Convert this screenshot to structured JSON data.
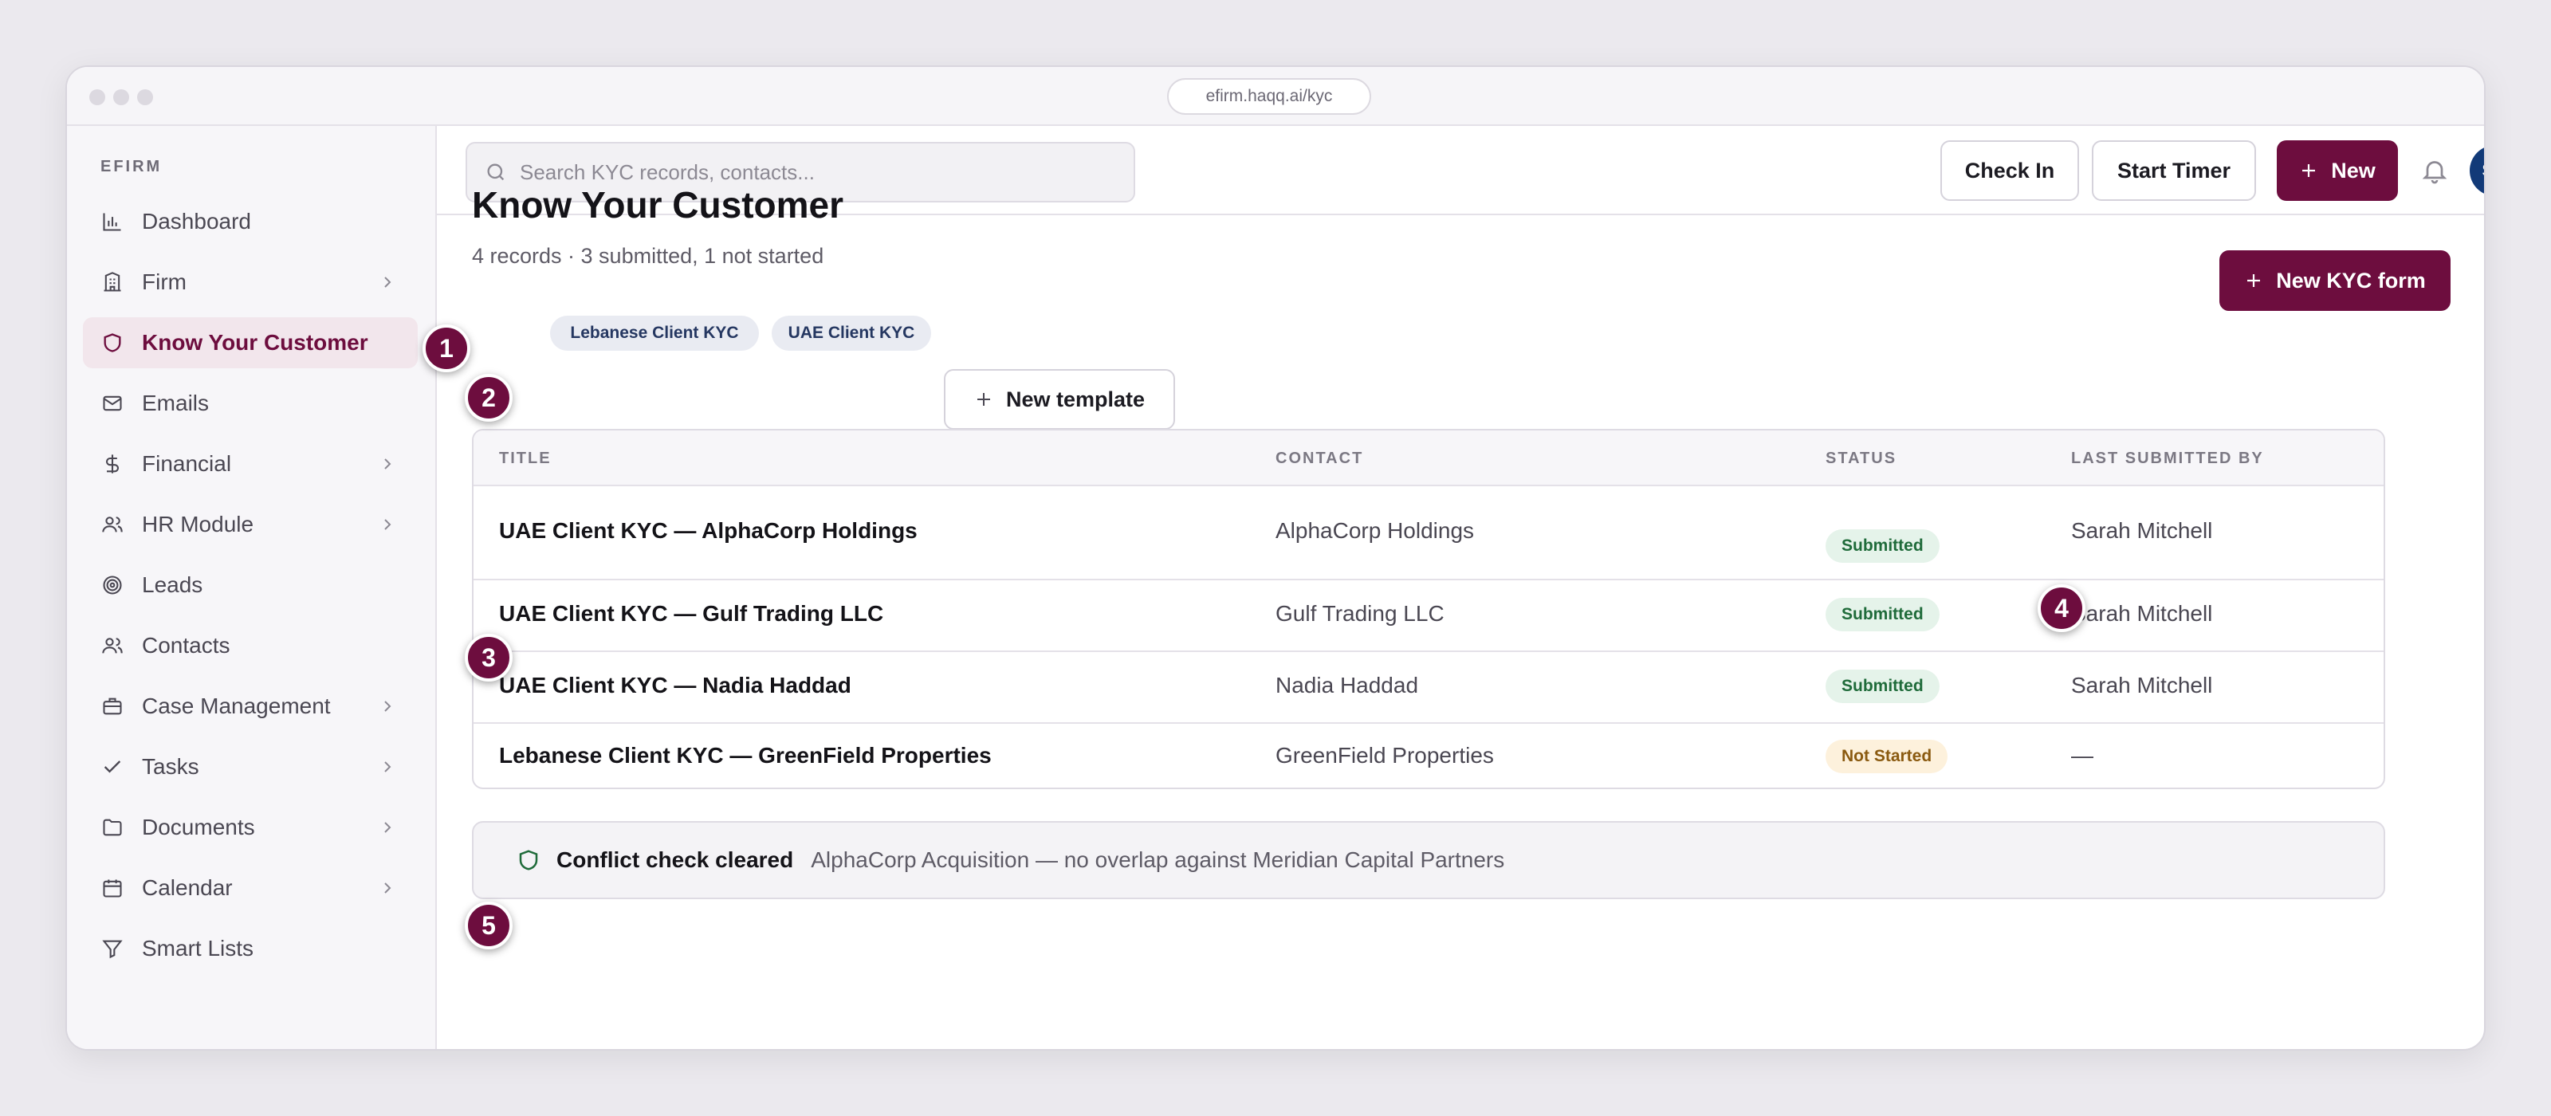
{
  "browser": {
    "url": "efirm.haqq.ai/kyc"
  },
  "sidebar": {
    "brand": "EFIRM",
    "items": [
      {
        "label": "Dashboard",
        "icon": "bar-chart-icon",
        "has_submenu": false
      },
      {
        "label": "Firm",
        "icon": "building-icon",
        "has_submenu": true
      },
      {
        "label": "Know Your Customer",
        "icon": "shield-icon",
        "has_submenu": false,
        "active": true
      },
      {
        "label": "Emails",
        "icon": "mail-icon",
        "has_submenu": false
      },
      {
        "label": "Financial",
        "icon": "dollar-icon",
        "has_submenu": true
      },
      {
        "label": "HR Module",
        "icon": "users-icon",
        "has_submenu": true
      },
      {
        "label": "Leads",
        "icon": "target-icon",
        "has_submenu": false
      },
      {
        "label": "Contacts",
        "icon": "contacts-icon",
        "has_submenu": false
      },
      {
        "label": "Case Management",
        "icon": "briefcase-icon",
        "has_submenu": true
      },
      {
        "label": "Tasks",
        "icon": "check-icon",
        "has_submenu": true
      },
      {
        "label": "Documents",
        "icon": "folder-icon",
        "has_submenu": true
      },
      {
        "label": "Calendar",
        "icon": "calendar-icon",
        "has_submenu": true
      },
      {
        "label": "Smart Lists",
        "icon": "filter-icon",
        "has_submenu": false
      }
    ]
  },
  "topbar": {
    "search_placeholder": "Search KYC records, contacts...",
    "check_in_label": "Check In",
    "start_timer_label": "Start Timer",
    "new_label": "New",
    "avatar_initials": "SM"
  },
  "page": {
    "title": "Know Your Customer",
    "subtitle": "4 records · 3 submitted, 1 not started",
    "new_form_label": "New KYC form",
    "templates": [
      "Lebanese Client KYC",
      "UAE Client KYC"
    ],
    "new_template_label": "New template"
  },
  "table": {
    "columns": [
      "TITLE",
      "CONTACT",
      "STATUS",
      "LAST SUBMITTED BY"
    ],
    "rows": [
      {
        "title": "UAE Client KYC — AlphaCorp Holdings",
        "contact": "AlphaCorp Holdings",
        "status": "Submitted",
        "submitted_by": "Sarah Mitchell"
      },
      {
        "title": "UAE Client KYC — Gulf Trading LLC",
        "contact": "Gulf Trading LLC",
        "status": "Submitted",
        "submitted_by": "Sarah Mitchell"
      },
      {
        "title": "UAE Client KYC — Nadia Haddad",
        "contact": "Nadia Haddad",
        "status": "Submitted",
        "submitted_by": "Sarah Mitchell"
      },
      {
        "title": "Lebanese Client KYC — GreenField Properties",
        "contact": "GreenField Properties",
        "status": "Not Started",
        "submitted_by": "—"
      }
    ]
  },
  "banner": {
    "title": "Conflict check cleared",
    "text": "AlphaCorp Acquisition — no overlap against Meridian Capital Partners"
  },
  "markers": [
    "1",
    "2",
    "3",
    "4",
    "5"
  ],
  "colors": {
    "brand": "#6d0d3e",
    "avatar": "#123a78",
    "success": "#1f6b3a",
    "warning": "#8a5a10"
  }
}
